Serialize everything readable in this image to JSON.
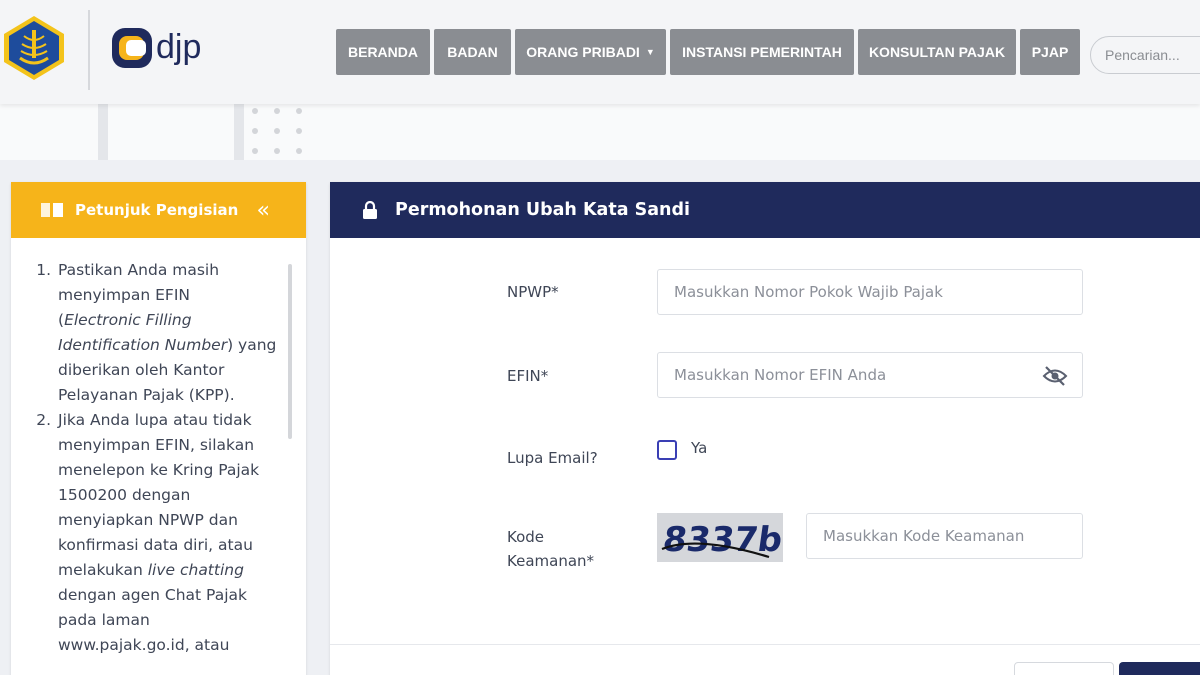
{
  "header": {
    "nav": [
      {
        "label": "BERANDA"
      },
      {
        "label": "BADAN"
      },
      {
        "label": "ORANG PRIBADI",
        "has_dropdown": true
      },
      {
        "label": "INSTANSI PEMERINTAH"
      },
      {
        "label": "KONSULTAN PAJAK"
      },
      {
        "label": "PJAP"
      }
    ],
    "search_placeholder": "Pencarian...",
    "logo_text": "djp"
  },
  "guide": {
    "title": "Petunjuk Pengisian",
    "collapse_icon": "double-chevron-left-icon"
  },
  "form": {
    "title": "Permohonan Ubah Kata Sandi",
    "npwp_label": "NPWP*",
    "npwp_placeholder": "Masukkan Nomor Pokok Wajib Pajak",
    "efin_label": "EFIN*",
    "efin_placeholder": "Masukkan Nomor EFIN Anda",
    "lupa_email_label": "Lupa Email?",
    "ya_label": "Ya",
    "kode_label_1": "Kode",
    "kode_label_2": "Keamanan*",
    "captcha_text": "8337b",
    "kode_placeholder": "Masukkan Kode Keamanan"
  },
  "colors": {
    "accent_yellow": "#f6b41a",
    "navy": "#1f2a5c",
    "nav_gray": "#8a8d92"
  }
}
